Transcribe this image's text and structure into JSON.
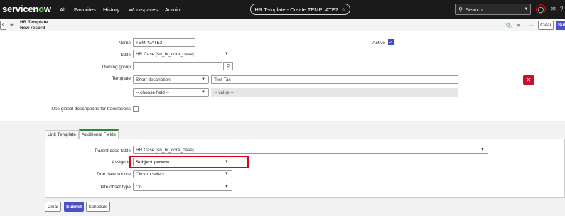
{
  "nav": {
    "logo_a": "servicen",
    "logo_o": "o",
    "logo_b": "w",
    "links": [
      "All",
      "Favorites",
      "History",
      "Workspaces",
      "Admin"
    ],
    "context_title": "HR Template - Create TEMPLATE2",
    "star": "☆",
    "search_placeholder": "Search"
  },
  "form_header": {
    "title": "HR Template",
    "subtitle": "New record",
    "clear_label": "Clear",
    "submit_label": "Sub"
  },
  "fields": {
    "name_label": "Name",
    "name_value": "TEMPLATE2",
    "active_label": "Active",
    "active_checked": true,
    "table_label": "Table",
    "table_value": "HR Case [sn_hr_core_case]",
    "owning_group_label": "Owning group",
    "owning_group_value": "",
    "template_label": "Template",
    "template_field": "Short description",
    "template_value": "Test Tas",
    "choose_field": "-- choose field --",
    "value_placeholder": "-- value --",
    "global_desc_label": "Use global descriptions for translations"
  },
  "tabs": [
    "Link Template",
    "Additional Fields"
  ],
  "additional": {
    "parent_case_table_label": "Parent case table",
    "parent_case_table_value": "HR Case [sn_hr_core_case]",
    "assign_to_label": "Assign to",
    "assign_to_value": "Subject person",
    "due_date_source_label": "Due date source",
    "due_date_source_value": "Click to select...",
    "date_offset_type_label": "Date offset type",
    "date_offset_type_value": "On"
  },
  "buttons": {
    "clear": "Clear",
    "submit": "Submit",
    "schedule": "Schedule"
  }
}
